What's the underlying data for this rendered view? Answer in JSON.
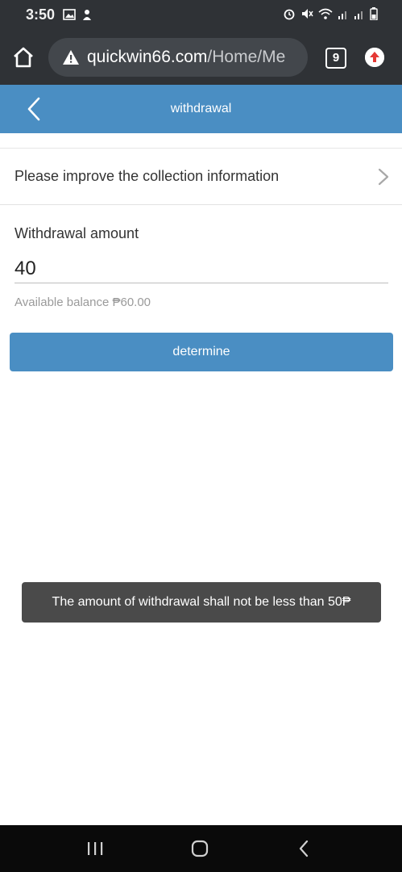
{
  "status_bar": {
    "time": "3:50"
  },
  "browser": {
    "url_host": "quickwin66.com",
    "url_path": "/Home/Me",
    "tab_count": "9"
  },
  "header": {
    "title": "withdrawal"
  },
  "collection": {
    "label": "Please improve the collection information"
  },
  "withdrawal": {
    "amount_label": "Withdrawal amount",
    "amount_value": "40",
    "balance_text": "Available balance ₱60.00"
  },
  "actions": {
    "determine_label": "determine"
  },
  "toast": {
    "message": "The amount of withdrawal shall not be less than 50₱"
  },
  "icons": {
    "home": "home-icon",
    "warning": "warning-icon",
    "tabs": "tabs-counter-icon",
    "update": "update-icon",
    "back": "back-arrow-icon",
    "chevron": "chevron-right-icon",
    "nav_recents": "recents-icon",
    "nav_home": "nav-home-icon",
    "nav_back": "nav-back-icon"
  },
  "colors": {
    "header_blue": "#4a8ec3",
    "browser_dark": "#2f3236",
    "toast_bg": "#4a4a4a"
  }
}
